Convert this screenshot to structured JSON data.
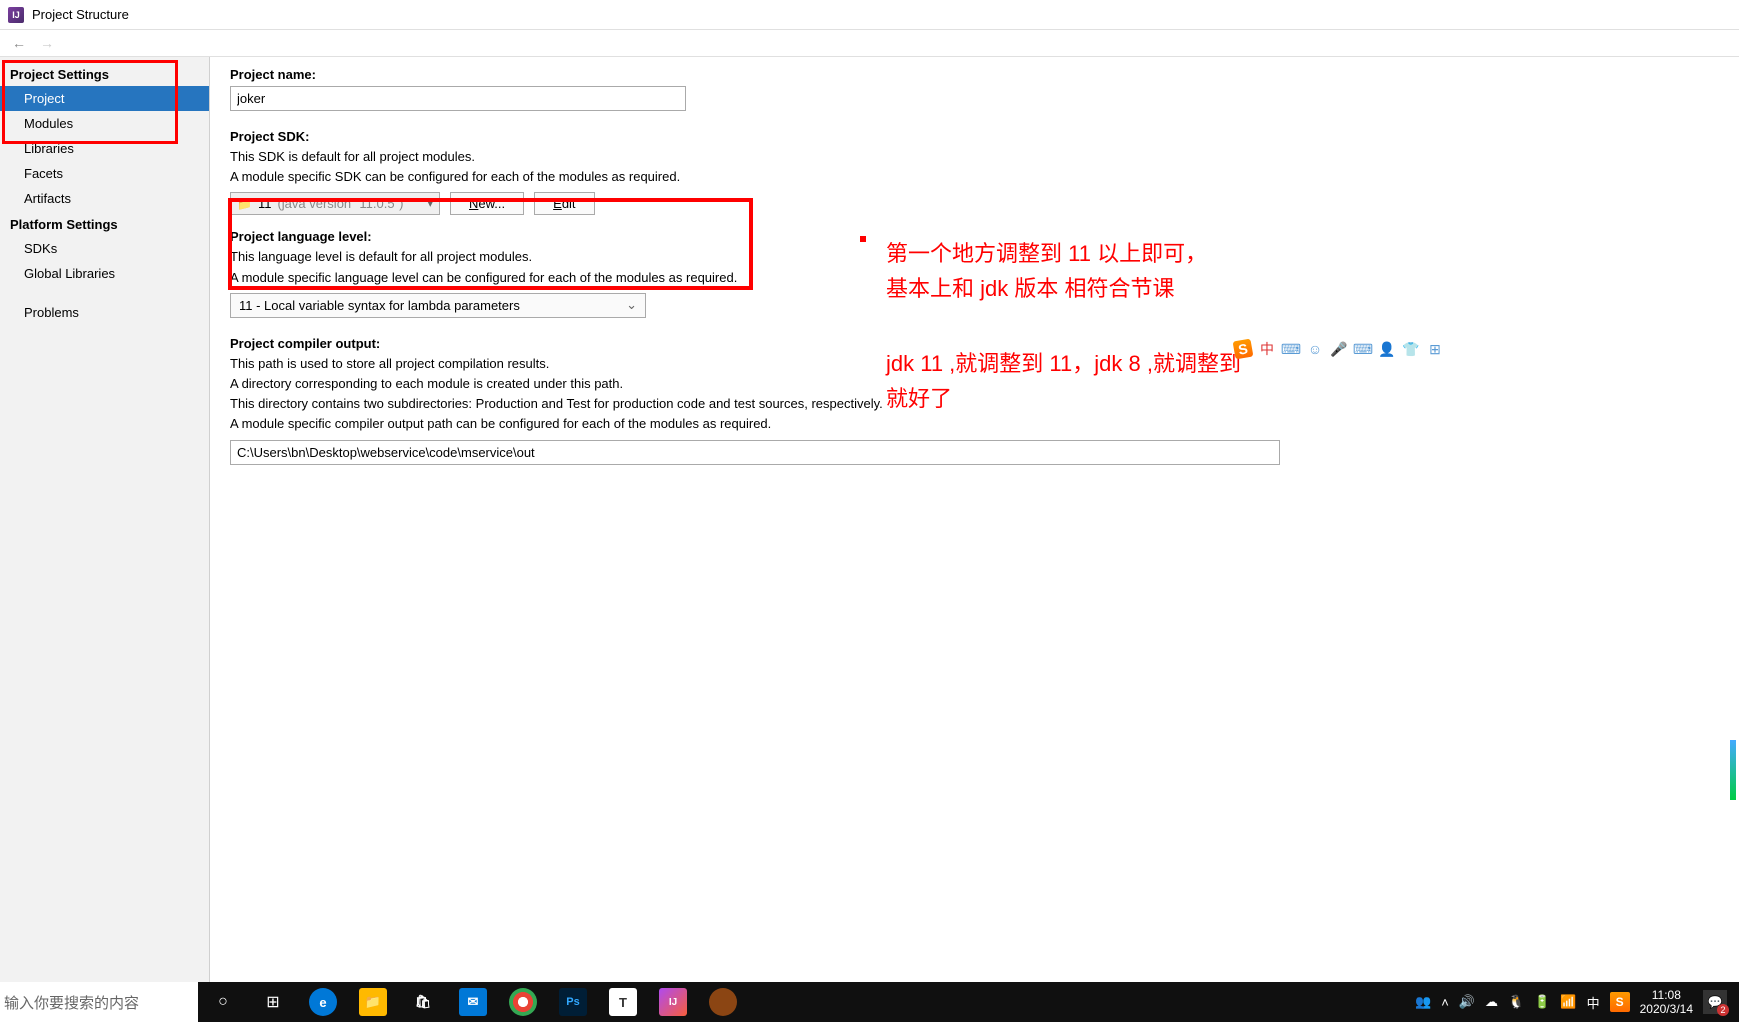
{
  "window": {
    "title": "Project Structure"
  },
  "sidebar": {
    "sections": [
      {
        "header": "Project Settings",
        "items": [
          {
            "label": "Project",
            "selected": true
          },
          {
            "label": "Modules"
          },
          {
            "label": "Libraries"
          },
          {
            "label": "Facets"
          },
          {
            "label": "Artifacts"
          }
        ]
      },
      {
        "header": "Platform Settings",
        "items": [
          {
            "label": "SDKs"
          },
          {
            "label": "Global Libraries"
          }
        ]
      },
      {
        "header": "",
        "items": [
          {
            "label": "Problems"
          }
        ]
      }
    ]
  },
  "form": {
    "project_name_label": "Project name:",
    "project_name_value": "joker",
    "sdk_label": "Project SDK:",
    "sdk_desc1": "This SDK is default for all project modules.",
    "sdk_desc2": "A module specific SDK can be configured for each of the modules as required.",
    "sdk_value_main": "11",
    "sdk_value_gray": "(java version \"11.0.5\")",
    "new_btn": "New...",
    "edit_btn": "Edit",
    "lang_label": "Project language level:",
    "lang_desc1": "This language level is default for all project modules.",
    "lang_desc2": "A module specific language level can be configured for each of the modules as required.",
    "lang_value": "11 - Local variable syntax for lambda parameters",
    "output_label": "Project compiler output:",
    "output_desc1": "This path is used to store all project compilation results.",
    "output_desc2": "A directory corresponding to each module is created under this path.",
    "output_desc3": "This directory contains two subdirectories: Production and Test for production code and test sources, respectively.",
    "output_desc4": "A module specific compiler output path can be configured for each of the modules as required.",
    "output_value": "C:\\Users\\bn\\Desktop\\webservice\\code\\mservice\\out"
  },
  "annotations": {
    "line1": "第一个地方调整到 11 以上即可，",
    "line2": "基本上和 jdk 版本 相符合节课",
    "line3": "jdk 11 ,就调整到 11，jdk 8 ,就调整到",
    "line4": "就好了"
  },
  "taskbar": {
    "search_placeholder": "输入你要搜索的内容",
    "time": "11:08",
    "date": "2020/3/14",
    "ime": "中"
  }
}
